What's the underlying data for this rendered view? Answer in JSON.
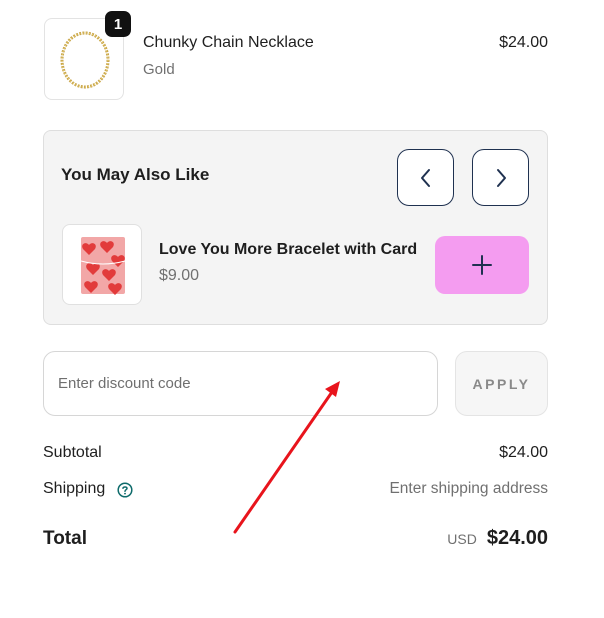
{
  "line_item": {
    "quantity": "1",
    "title": "Chunky Chain Necklace",
    "variant": "Gold",
    "price": "$24.00",
    "image_icon": "gold-necklace-image"
  },
  "recommendations": {
    "heading": "You May Also Like",
    "prev_icon": "chevron-left-icon",
    "next_icon": "chevron-right-icon",
    "item": {
      "title": "Love You More Bracelet with Card",
      "price": "$9.00",
      "image_icon": "heart-card-image",
      "add_icon": "plus-icon"
    },
    "add_button_color": "#f49cf0"
  },
  "discount": {
    "placeholder": "Enter discount code",
    "apply_label": "APPLY"
  },
  "summary": {
    "subtotal_label": "Subtotal",
    "subtotal_value": "$24.00",
    "shipping_label": "Shipping",
    "shipping_value": "Enter shipping address",
    "help_icon": "question-circle-icon",
    "total_label": "Total",
    "currency": "USD",
    "total_value": "$24.00"
  },
  "colors": {
    "accent_navy": "#1f3150",
    "annotation_arrow": "#e8141c",
    "help_teal": "#0e6b6b"
  }
}
